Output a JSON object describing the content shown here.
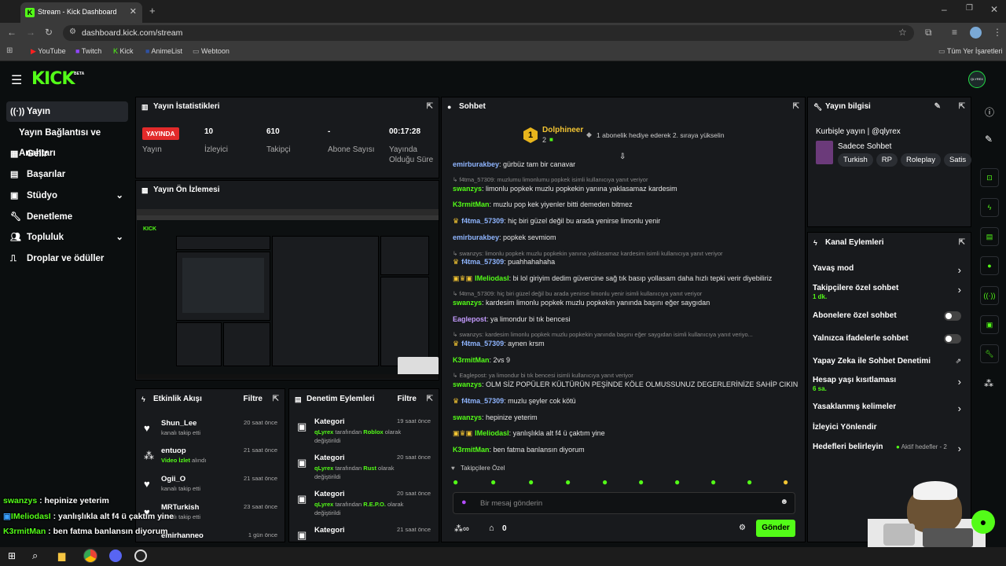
{
  "browser": {
    "tab_title": "Stream - Kick Dashboard",
    "url": "dashboard.kick.com/stream",
    "bookmarks": [
      "YouTube",
      "Twitch",
      "Kick",
      "AnimeList",
      "Webtoon"
    ],
    "all_bookmarks": "Tüm Yer İşaretleri"
  },
  "header": {
    "logo": "KICK",
    "beta": "BETA",
    "avatar": "QLYREX"
  },
  "sidebar": {
    "items": [
      {
        "label": "Yayın",
        "icon": "broadcast-icon"
      },
      {
        "label": "Yayın Bağlantısı ve Anahtarı"
      },
      {
        "label": "Gelir",
        "icon": "revenue-icon"
      },
      {
        "label": "Başarılar",
        "icon": "achievements-icon"
      },
      {
        "label": "Stüdyo",
        "icon": "studio-icon"
      },
      {
        "label": "Denetleme",
        "icon": "wrench-icon"
      },
      {
        "label": "Topluluk",
        "icon": "community-icon"
      },
      {
        "label": "Droplar ve ödüller",
        "icon": "drops-icon"
      }
    ]
  },
  "stats": {
    "title": "Yayın İstatistikleri",
    "items": [
      {
        "value": "YAYINDA",
        "label": "Yayın"
      },
      {
        "value": "10",
        "label": "İzleyici"
      },
      {
        "value": "610",
        "label": "Takipçi"
      },
      {
        "value": "-",
        "label": "Abone Sayısı"
      },
      {
        "value": "00:17:28",
        "label": "Yayında Olduğu Süre"
      }
    ]
  },
  "preview": {
    "title": "Yayın Ön İzlemesi"
  },
  "activity": {
    "title": "Etkinlik Akışı",
    "filter": "Filtre",
    "items": [
      {
        "name": "Shun_Lee",
        "sub": "kanalı takip etti",
        "time": "20 saat önce"
      },
      {
        "name": "entuop",
        "sub_green": "Video İzlet",
        "sub": " alındı",
        "time": "21 saat önce"
      },
      {
        "name": "Ogii_O",
        "sub": "kanalı takip etti",
        "time": "21 saat önce"
      },
      {
        "name": "MRTurkish",
        "sub": "kanalı takip etti",
        "time": "23 saat önce"
      },
      {
        "name": "emirhanneo",
        "sub": "",
        "time": "1 gün önce"
      }
    ]
  },
  "moderation": {
    "title": "Denetim Eylemleri",
    "filter": "Filtre",
    "items": [
      {
        "name": "Kategori",
        "user": "qLyrex",
        "mid": " tarafından ",
        "value": "Roblox",
        "end": " olarak değiştirildi",
        "time": "19 saat önce"
      },
      {
        "name": "Kategori",
        "user": "qLyrex",
        "mid": " tarafından ",
        "value": "Rust",
        "end": " olarak değiştirildi",
        "time": "20 saat önce"
      },
      {
        "name": "Kategori",
        "user": "qLyrex",
        "mid": " tarafından ",
        "value": "R.E.P.O.",
        "end": " olarak değiştirildi",
        "time": "20 saat önce"
      },
      {
        "name": "Kategori",
        "user": "",
        "mid": "",
        "value": "",
        "end": "",
        "time": "21 saat önce"
      }
    ]
  },
  "chat": {
    "title": "Sohbet",
    "pinned_user": "Dolphineer",
    "pinned_rank": "1",
    "pinned_count": "2",
    "pinned_msg": "1 abonelik hediye ederek 2. sıraya yükselin",
    "messages": [
      {
        "type": "msg",
        "user": "emirburakbey",
        "color": "#8fb5ff",
        "text": ": gürbüz tam bir canavar"
      },
      {
        "type": "reply",
        "text": "f4tma_57309: muzlumu limonlumu popkek isimli kullanıcıya yanıt veriyor"
      },
      {
        "type": "msg",
        "user": "swanzys",
        "color": "#53fc18",
        "text": ": limonlu popkek muzlu popkekin yanına yaklasamaz kardesim"
      },
      {
        "type": "msg",
        "user": "K3rmitMan",
        "color": "#53fc18",
        "text": ": muzlu pop kek yiyenler bitti demeden bitmez"
      },
      {
        "type": "msg",
        "user": "f4tma_57309",
        "color": "#8fb5ff",
        "badges": "crown",
        "text": ": hiç biri güzel değil bu arada yenirse limonlu yenir"
      },
      {
        "type": "msg",
        "user": "emirburakbey",
        "color": "#8fb5ff",
        "text": ": popkek sevmiom"
      },
      {
        "type": "reply",
        "text": "swanzys: limonlu popkek muzlu popkekin yanına yaklasamaz kardesim isimli kullanıcıya yanıt veriyor"
      },
      {
        "type": "msg",
        "user": "f4tma_57309",
        "color": "#8fb5ff",
        "badges": "crown",
        "text": ": puahhahahaha"
      },
      {
        "type": "msg",
        "user": "IMeliodasI",
        "color": "#53fc18",
        "badges": "three",
        "text": ": bi lol giriyim dedim güvercine sağ tık basıp yollasam daha hızlı tepki verir diyebiliriz"
      },
      {
        "type": "reply",
        "text": "f4tma_57309: hiç biri güzel değil bu arada yenirse limonlu yenir isimli kullanıcıya yanıt veriyor"
      },
      {
        "type": "msg",
        "user": "swanzys",
        "color": "#53fc18",
        "text": ": kardesim limonlu popkek muzlu popkekin yanında başını eğer saygıdan"
      },
      {
        "type": "msg",
        "user": "Eaglepost",
        "color": "#c59cff",
        "text": ": ya limondur bi tık bencesi"
      },
      {
        "type": "reply",
        "text": "swanzys: kardesim limonlu popkek muzlu popkekin yanında başını eğer saygıdan isimli kullanıcıya yanıt veriyo..."
      },
      {
        "type": "msg",
        "user": "f4tma_57309",
        "color": "#8fb5ff",
        "badges": "crown",
        "text": ": aynen krsm"
      },
      {
        "type": "msg",
        "user": "K3rmitMan",
        "color": "#53fc18",
        "text": ": 2vs 9"
      },
      {
        "type": "reply",
        "text": "Eaglepost: ya limondur bi tık bencesi isimli kullanıcıya yanıt veriyor"
      },
      {
        "type": "msg",
        "user": "swanzys",
        "color": "#53fc18",
        "text": ": OLM SİZ POPÜLER KÜLTÜRÜN PEŞİNDE KÖLE OLMUSSUNUZ DEGERLERİNİZE SAHİP CIKIN"
      },
      {
        "type": "msg",
        "user": "f4tma_57309",
        "color": "#8fb5ff",
        "badges": "crown",
        "text": ": muzlu şeyler cok kötü"
      },
      {
        "type": "msg",
        "user": "swanzys",
        "color": "#53fc18",
        "text": ": hepinize yeterim"
      },
      {
        "type": "msg",
        "user": "IMeliodasI",
        "color": "#53fc18",
        "badges": "three",
        "text": ": yanlışlıkla alt f4 ü çaktım yine"
      },
      {
        "type": "msg",
        "user": "K3rmitMan",
        "color": "#53fc18",
        "text": ": ben fatma banlansın diyorum"
      }
    ],
    "followers_only": "Takipçilere Özel",
    "input_placeholder": "Bir mesaj gönderin",
    "send": "Gönder",
    "points": "0"
  },
  "info": {
    "title": "Yayın bilgisi",
    "stream_title": "Kurbişle yayın | @qlyrex",
    "category": "Sadece Sohbet",
    "tags": [
      "Turkish",
      "RP",
      "Roleplay",
      "Satis"
    ]
  },
  "actions": {
    "title": "Kanal Eylemleri",
    "items": [
      {
        "label": "Yavaş mod",
        "kind": "arrow"
      },
      {
        "label": "Takipçilere özel sohbet",
        "sub": "1 dk.",
        "kind": "arrow"
      },
      {
        "label": "Abonelere özel sohbet",
        "kind": "toggle"
      },
      {
        "label": "Yalnızca ifadelerle sohbet",
        "kind": "toggle"
      },
      {
        "label": "Yapay Zeka ile Sohbet Denetimi",
        "kind": "ext"
      },
      {
        "label": "Hesap yaşı kısıtlaması",
        "sub": "6 sa.",
        "kind": "arrow"
      },
      {
        "label": "Yasaklanmış kelimeler",
        "kind": "arrow"
      },
      {
        "label": "İzleyici Yönlendir",
        "kind": "none"
      },
      {
        "label": "Hedefleri belirleyin",
        "note": "Aktif hedefler - 2",
        "kind": "arrow"
      }
    ]
  },
  "overlay": {
    "lines": [
      {
        "user": "swanzys",
        "text": " : hepinize yeterim"
      },
      {
        "user": "IMeliodasI",
        "text": " : yanlışlıkla alt f4 ü çaktım yine"
      },
      {
        "user": "K3rmitMan",
        "text": " : ben fatma banlansın diyorum"
      }
    ]
  }
}
